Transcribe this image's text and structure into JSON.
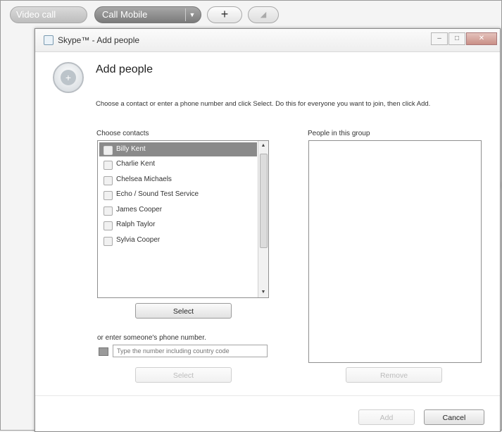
{
  "background": {
    "video_call": "Video call",
    "call_mobile": "Call Mobile",
    "dropdown_glyph": "▼",
    "plus_glyph": "+",
    "signal_glyph": "◢"
  },
  "dialog": {
    "title": "Skype™ - Add people",
    "window_buttons": {
      "minimize": "–",
      "maximize": "□",
      "close": "✕"
    },
    "heading": "Add people",
    "instructions": "Choose a contact or enter a phone number and click Select. Do this for everyone you want to join, then click Add.",
    "contacts_label": "Choose contacts",
    "people_label": "People in this group",
    "contacts": [
      {
        "name": "Billy Kent",
        "selected": true
      },
      {
        "name": "Charlie Kent",
        "selected": false
      },
      {
        "name": "Chelsea Michaels",
        "selected": false
      },
      {
        "name": "Echo / Sound Test Service",
        "selected": false
      },
      {
        "name": "James Cooper",
        "selected": false
      },
      {
        "name": "Ralph Taylor",
        "selected": false
      },
      {
        "name": "Sylvia Cooper",
        "selected": false
      }
    ],
    "select_button": "Select",
    "phone_label": "or enter someone's phone number.",
    "phone_placeholder": "Type the number including country code",
    "select_button_bottom": "Select",
    "remove_button": "Remove",
    "add_button": "Add",
    "cancel_button": "Cancel"
  },
  "colors": {
    "selection": "#8a8a8a",
    "call_button": "#8a8a8a"
  }
}
